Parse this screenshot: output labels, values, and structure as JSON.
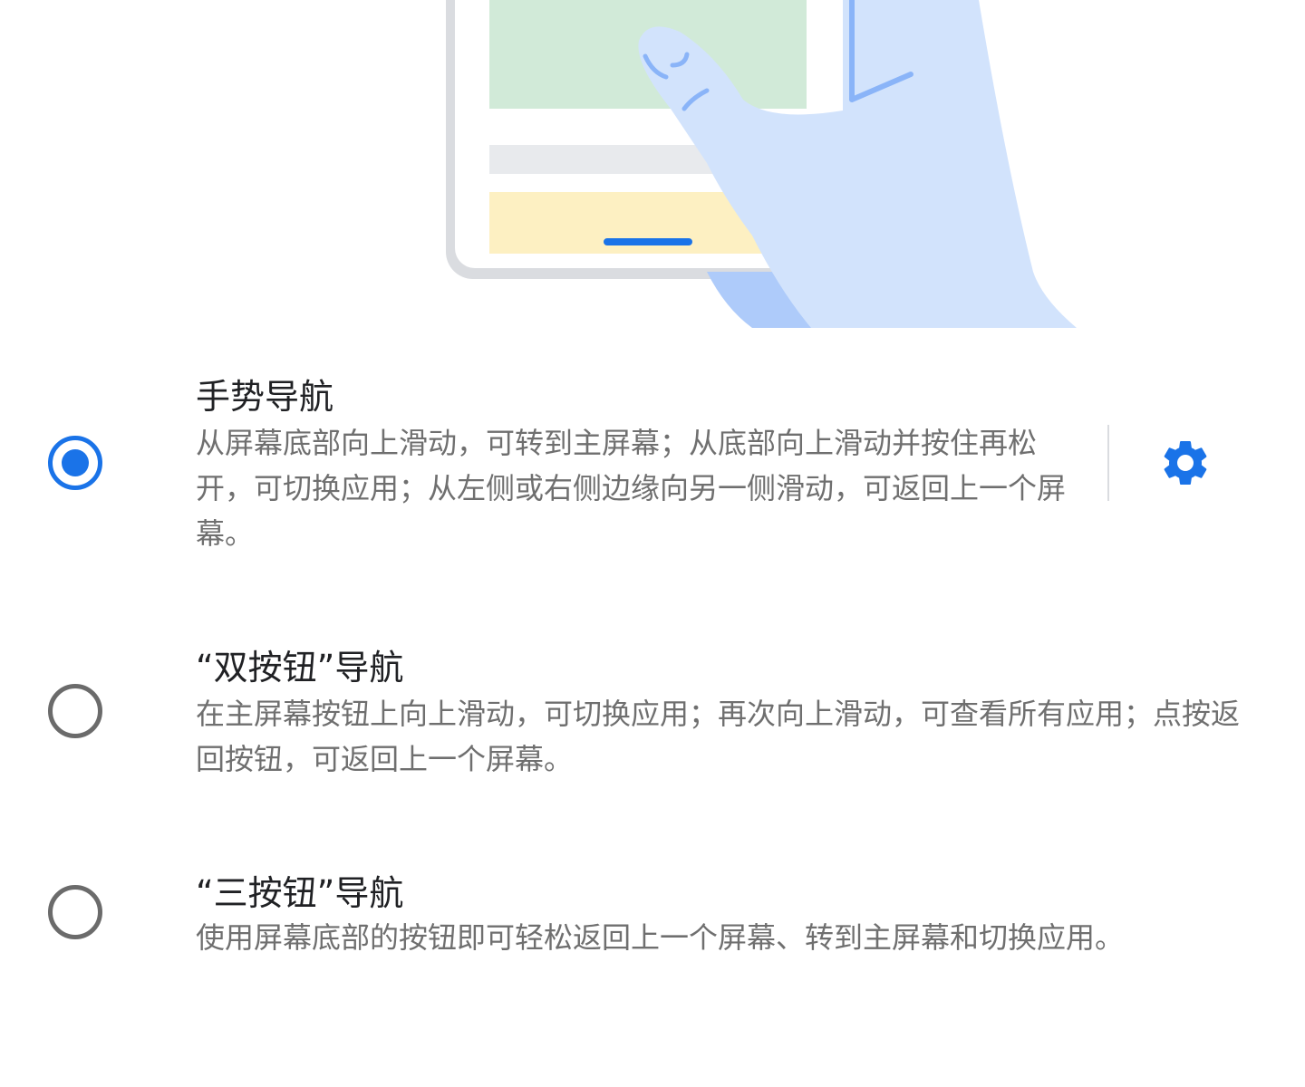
{
  "colors": {
    "accent": "#1a73e8",
    "title_text": "#202124",
    "description_text": "#6f6f6f",
    "radio_unselected": "#6b6b6b"
  },
  "illustration": {
    "icon": "phone-gesture-illustration"
  },
  "options": [
    {
      "title": "手势导航",
      "description": "从屏幕底部向上滑动，可转到主屏幕；从底部向上滑动并按住再松开，可切换应用；从左侧或右侧边缘向另一侧滑动，可返回上一个屏幕。",
      "selected": true,
      "settings_icon": "gear-icon"
    },
    {
      "title": "“双按钮”导航",
      "description": "在主屏幕按钮上向上滑动，可切换应用；再次向上滑动，可查看所有应用；点按返回按钮，可返回上一个屏幕。",
      "selected": false
    },
    {
      "title": "“三按钮”导航",
      "description": "使用屏幕底部的按钮即可轻松返回上一个屏幕、转到主屏幕和切换应用。",
      "selected": false
    }
  ]
}
